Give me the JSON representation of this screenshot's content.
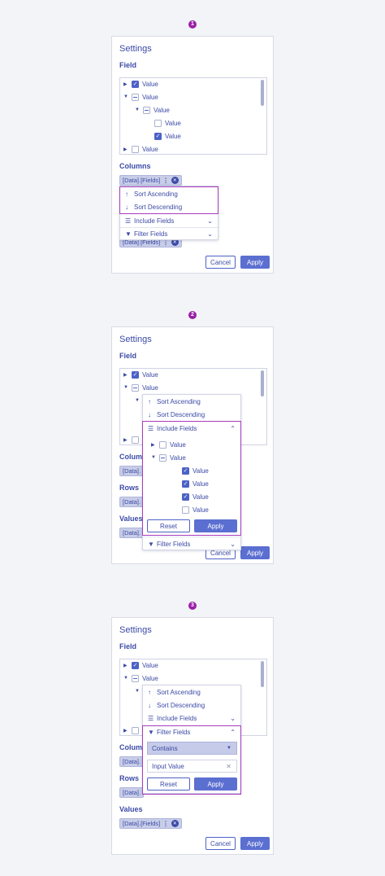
{
  "steps": [
    "1",
    "2",
    "3"
  ],
  "panel": {
    "title": "Settings",
    "field_label": "Field",
    "columns_label": "Columns",
    "rows_label": "Rows",
    "values_label": "Values",
    "chip_label": "[Data].[Fields]",
    "cancel": "Cancel",
    "apply": "Apply",
    "truncated_columns": "Column",
    "truncated_chip": "[Data]."
  },
  "tree_value": "Value",
  "menu": {
    "sort_asc": "Sort Ascending",
    "sort_desc": "Sort Descending",
    "include_fields": "Include Fields",
    "filter_fields": "Filter Fields",
    "reset": "Reset",
    "apply": "Apply"
  },
  "filter": {
    "condition": "Contains",
    "input_value": "Input Value"
  },
  "colors": {
    "accent": "#5b6fd1",
    "highlight": "#a93cbf",
    "chip": "#c8cde8"
  }
}
